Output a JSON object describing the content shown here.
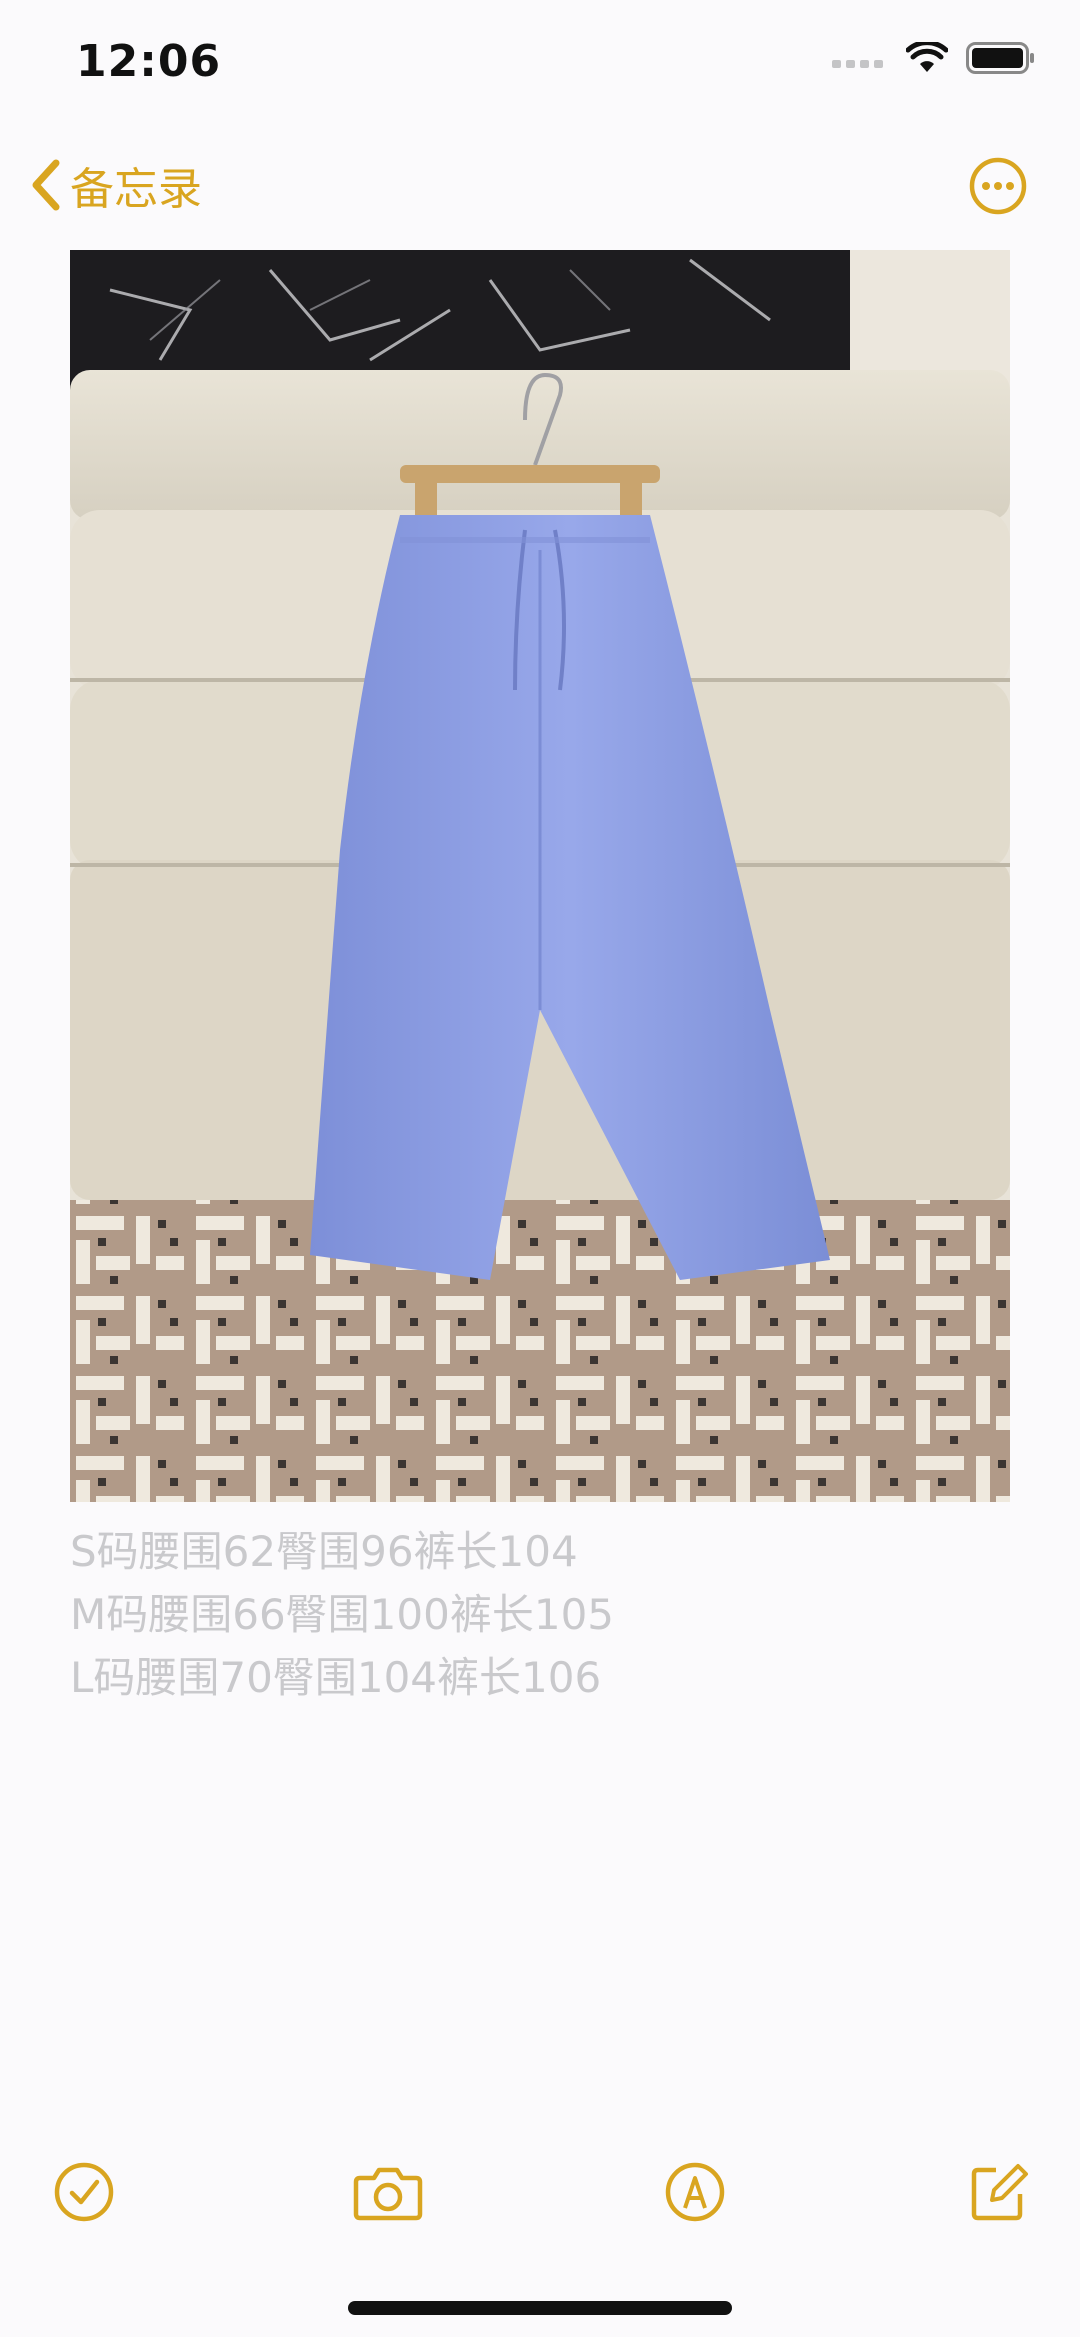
{
  "status_bar": {
    "time": "12:06"
  },
  "nav": {
    "back_label": "备忘录"
  },
  "note": {
    "lines": [
      "S码腰围62臀围96裤长104",
      "M码腰围66臀围100裤长105",
      "L码腰围70臀围104裤长106"
    ]
  },
  "icons": {
    "back": "chevron-left-icon",
    "more": "ellipsis-circle-icon",
    "checklist": "checkmark-circle-icon",
    "camera": "camera-icon",
    "markup": "pen-circle-icon",
    "compose": "compose-icon"
  },
  "colors": {
    "accent": "#d9a520",
    "note_text": "#c9c9cc",
    "background": "#fbfafc"
  }
}
